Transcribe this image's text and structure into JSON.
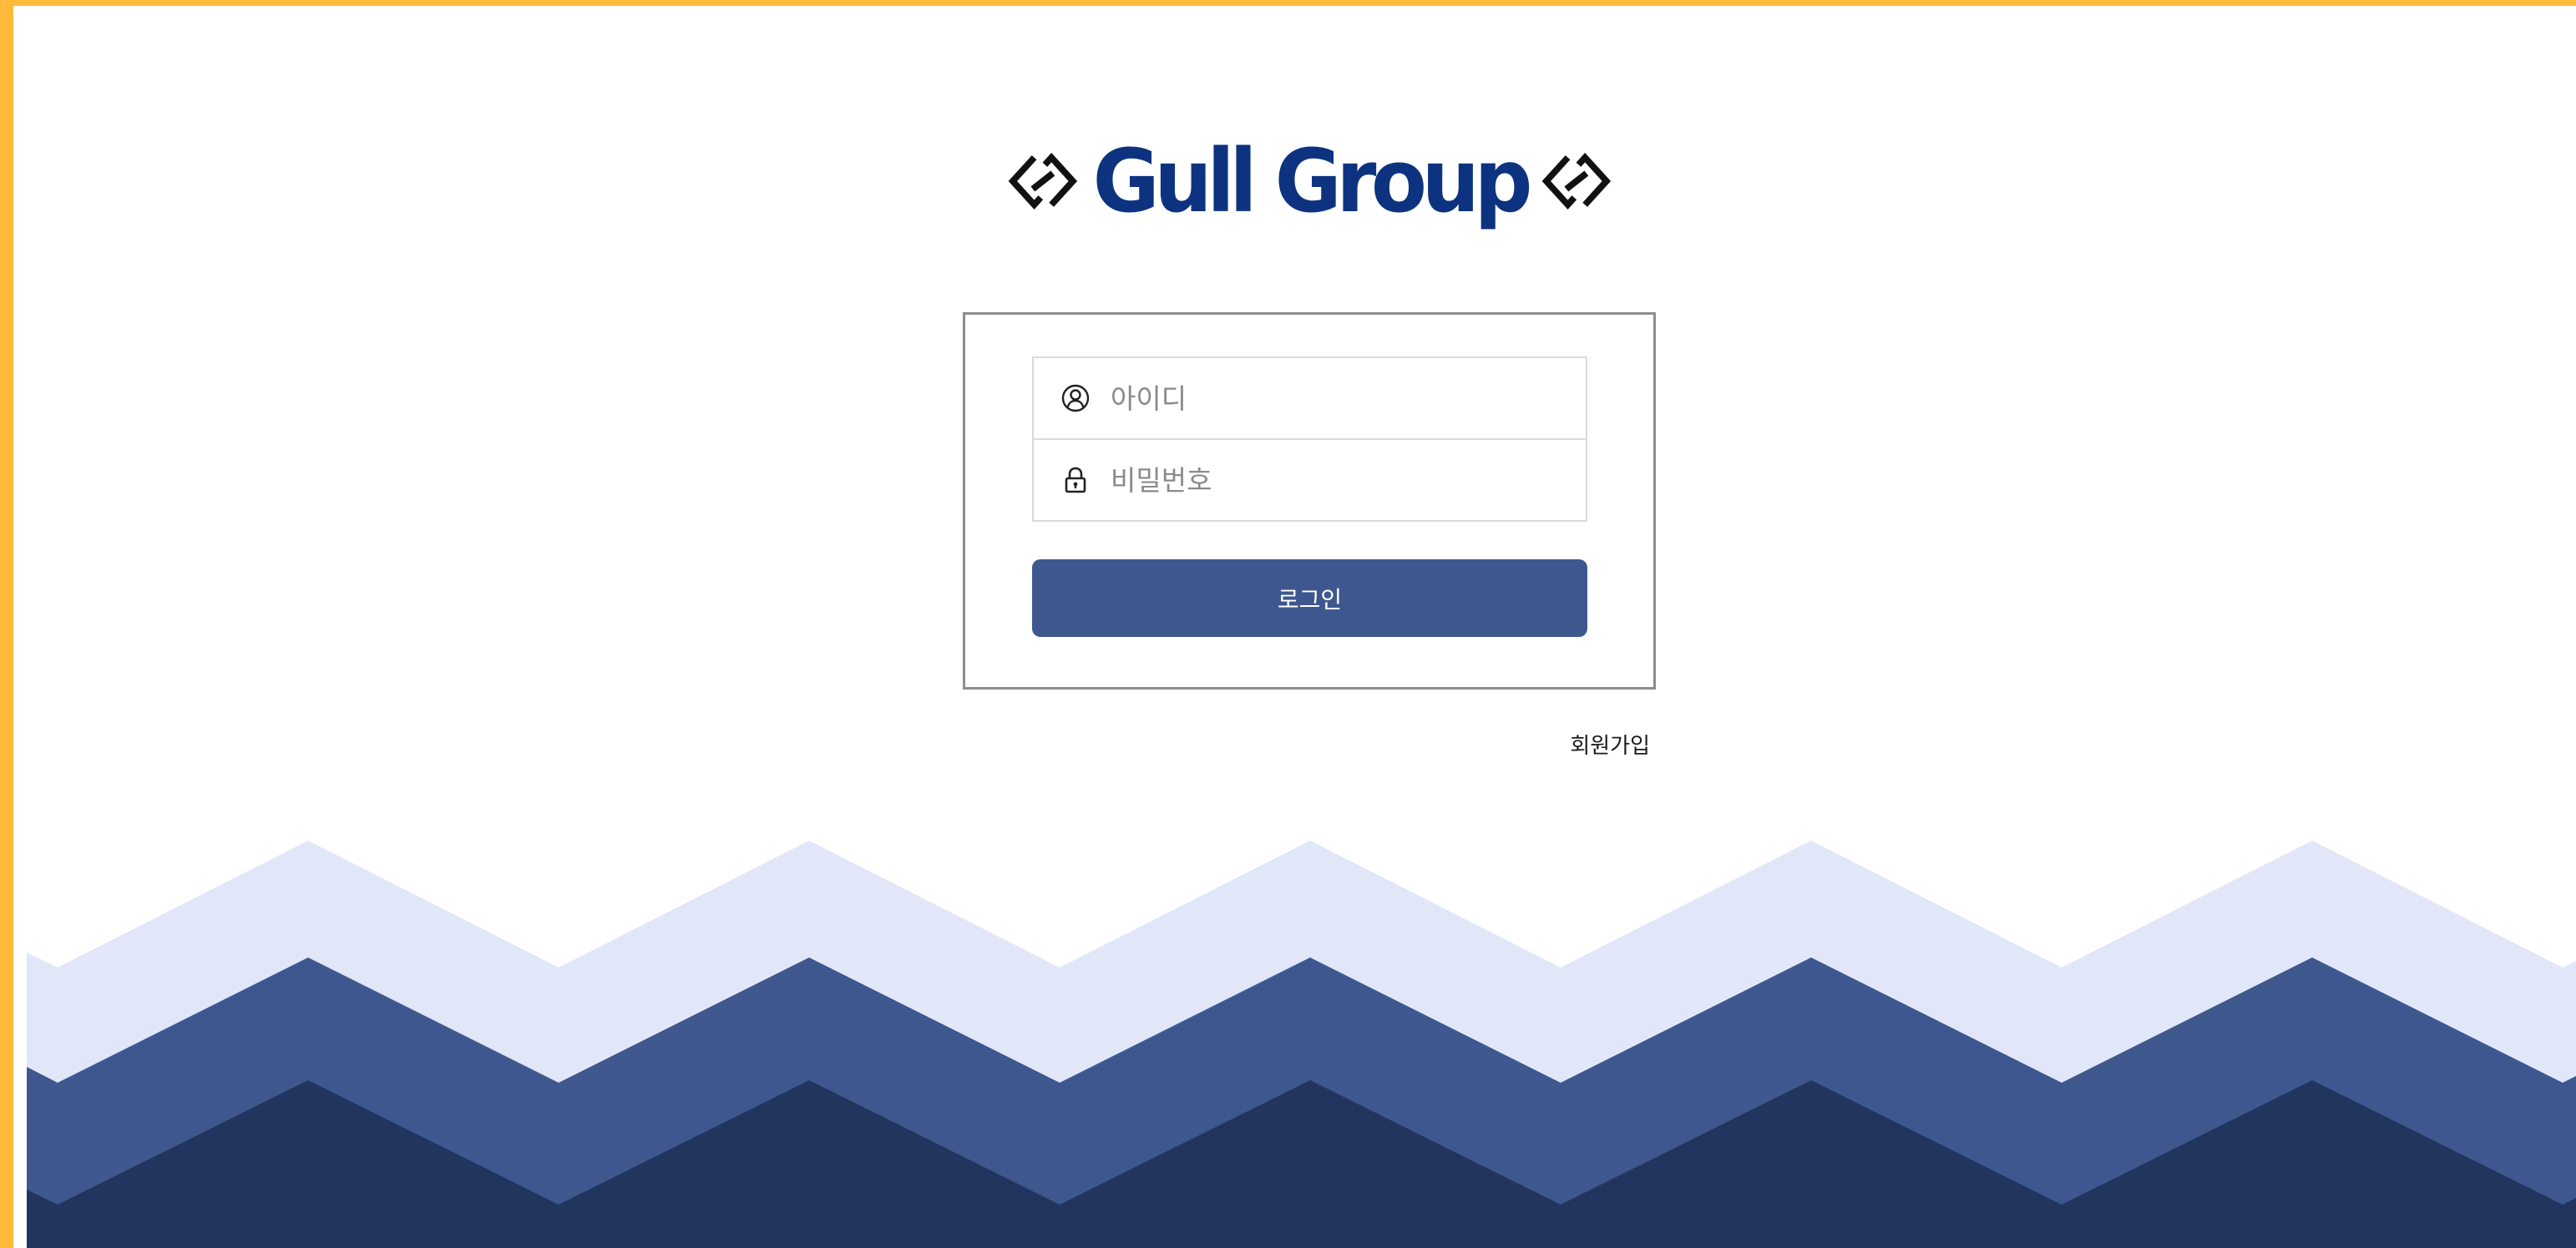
{
  "brand": {
    "name": "Gull Group",
    "logo_mark_icon": "double-bracket-logo-icon"
  },
  "login_form": {
    "id_placeholder": "아이디",
    "id_icon": "user-circle-icon",
    "password_placeholder": "비밀번호",
    "password_icon": "lock-icon",
    "login_label": "로그인"
  },
  "signup_label": "회원가입",
  "colors": {
    "frame": "#ffbb39",
    "brand": "#0d3380",
    "primary": "#3e588f",
    "wave_light": "#e1e7f8",
    "wave_mid": "#3e588f",
    "wave_dark": "#22355f"
  }
}
